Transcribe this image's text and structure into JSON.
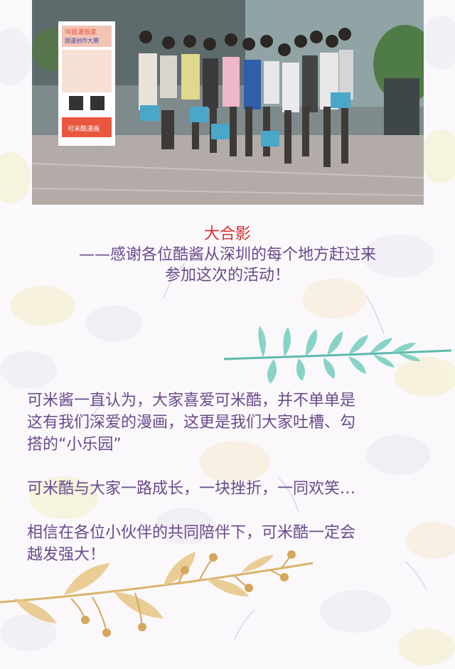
{
  "caption": {
    "title": "大合影",
    "line1": "——感谢各位酷酱从深圳的每个地方赶过来",
    "line2": "参加这次的活动！"
  },
  "banner": {
    "headline": "叫我漫画家",
    "sub": "国漫创作大赛",
    "brand": "可米酷漫画"
  },
  "body": {
    "p1_line1": "可米酱一直认为，大家喜爱可米酷，并不单单是",
    "p1_line2": "这有我们深爱的漫画，这更是我们大家吐槽、勾",
    "p1_line3": "搭的“小乐园”",
    "p2": "可米酷与大家一路成长，一块挫折，一同欢笑…",
    "p3_line1": "相信在各位小伙伴的共同陪伴下，可米酷一定会",
    "p3_line2": "越发强大！"
  },
  "colors": {
    "title_red": "#d9332b",
    "text_purple": "#6a4a8c",
    "teal_leaf": "#5fb9ad",
    "gold_leaf": "#d9b46a"
  }
}
